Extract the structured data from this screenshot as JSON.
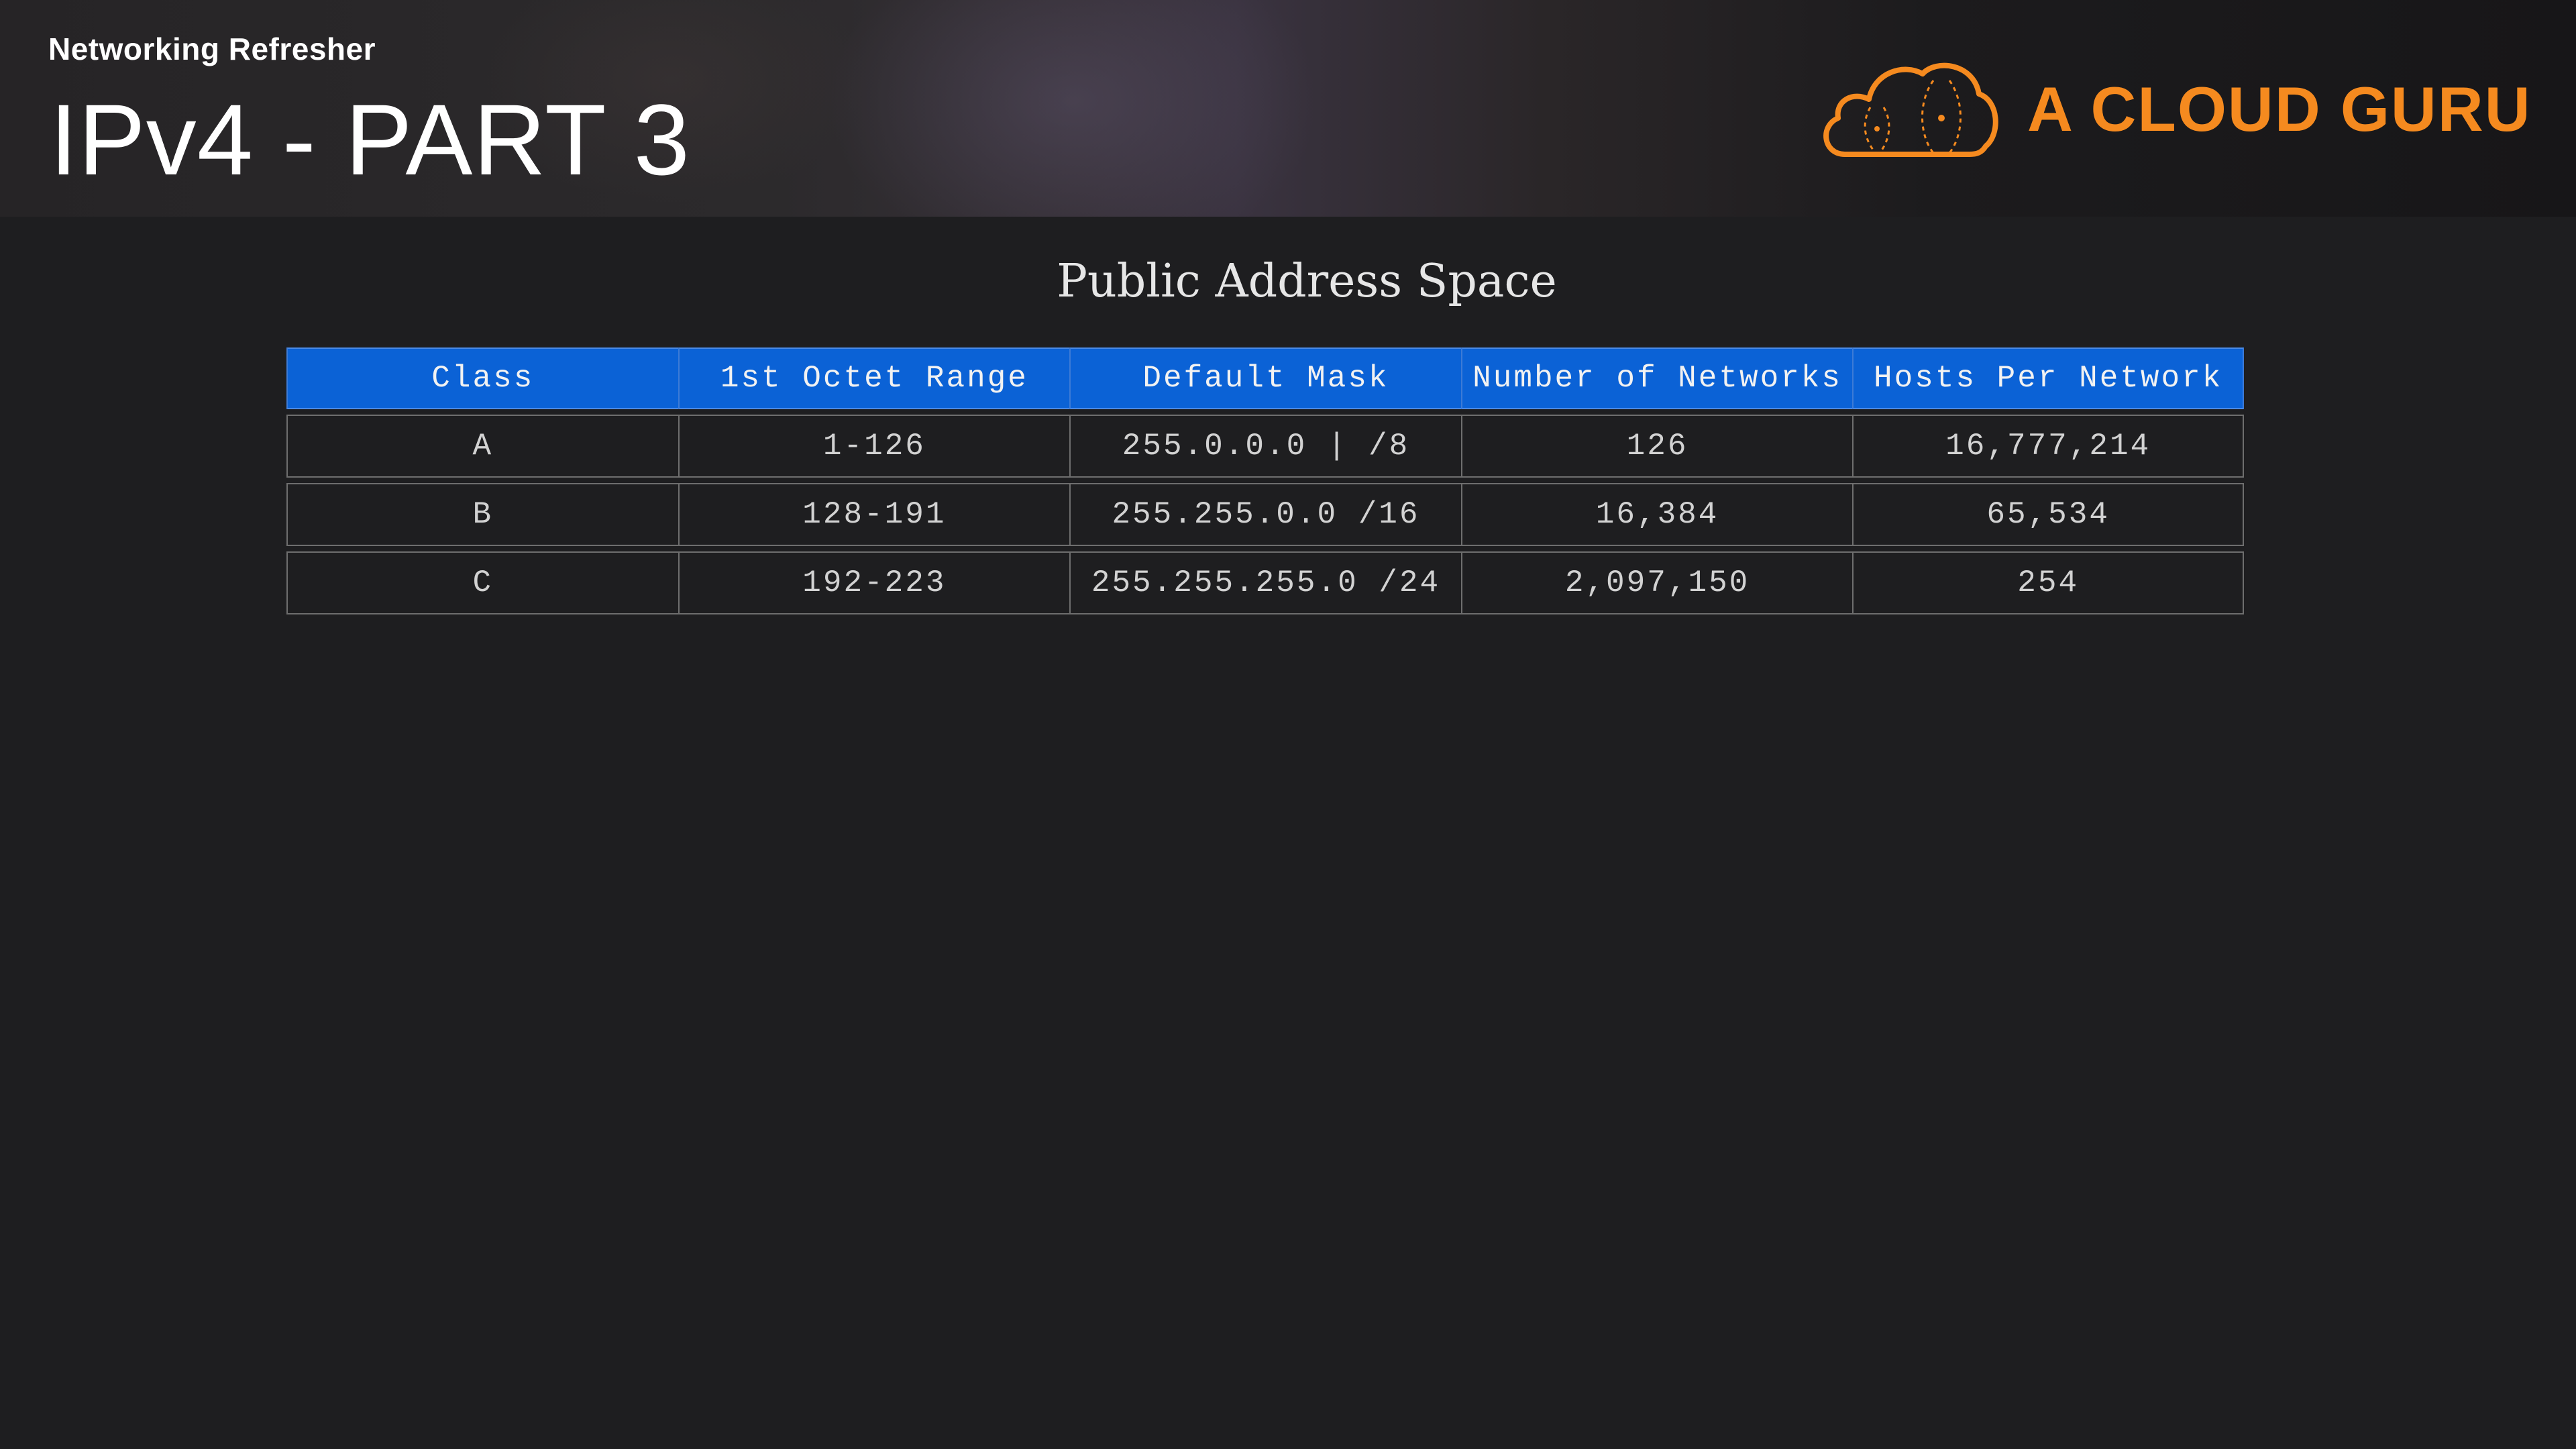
{
  "header": {
    "course_name": "Networking Refresher",
    "lesson_title": "IPv4 - PART 3"
  },
  "logo": {
    "text": "A CLOUD GURU",
    "icon": "cloud-icon",
    "brand_color": "#f58a1f"
  },
  "slide": {
    "heading": "Public Address Space",
    "table": {
      "header_color": "#0b62d6",
      "columns": [
        "Class",
        "1st Octet Range",
        "Default Mask",
        "Number of Networks",
        "Hosts Per Network"
      ],
      "rows": [
        [
          "A",
          "1-126",
          "255.0.0.0 | /8",
          "126",
          "16,777,214"
        ],
        [
          "B",
          "128-191",
          "255.255.0.0 /16",
          "16,384",
          "65,534"
        ],
        [
          "C",
          "192-223",
          "255.255.255.0 /24",
          "2,097,150",
          "254"
        ]
      ]
    }
  }
}
